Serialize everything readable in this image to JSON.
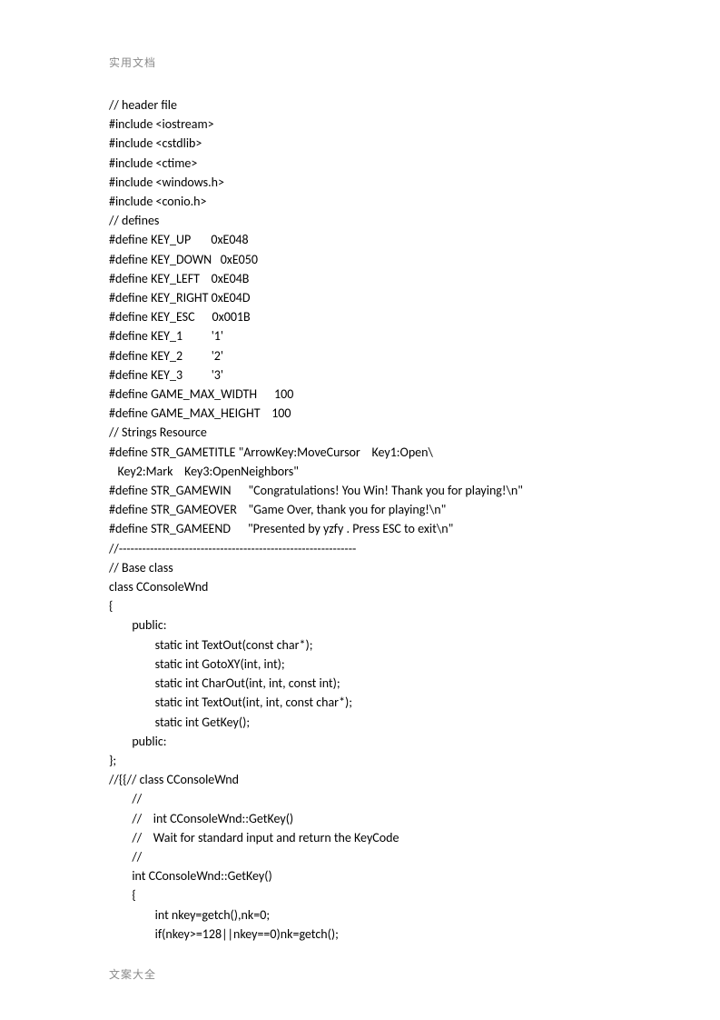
{
  "header": "实用文档",
  "footer": "文案大全",
  "code_lines": [
    "// header file",
    "#include <iostream>",
    "#include <cstdlib>",
    "#include <ctime>",
    "#include <windows.h>",
    "#include <conio.h>",
    "// defines",
    "#define KEY_UP       0xE048",
    "#define KEY_DOWN   0xE050",
    "#define KEY_LEFT    0xE04B",
    "#define KEY_RIGHT 0xE04D",
    "#define KEY_ESC      0x001B",
    "#define KEY_1          '1'",
    "#define KEY_2          '2'",
    "#define KEY_3          '3'",
    "#define GAME_MAX_WIDTH      100",
    "#define GAME_MAX_HEIGHT    100",
    "// Strings Resource",
    "#define STR_GAMETITLE \"ArrowKey:MoveCursor    Key1:Open\\",
    "   Key2:Mark    Key3:OpenNeighbors\"",
    "#define STR_GAMEWIN      \"Congratulations! You Win! Thank you for playing!\\n\"",
    "#define STR_GAMEOVER    \"Game Over, thank you for playing!\\n\"",
    "#define STR_GAMEEND      \"Presented by yzfy . Press ESC to exit\\n\"",
    "//-------------------------------------------------------------",
    "// Base class",
    "class CConsoleWnd",
    "{",
    "        public:",
    "                static int TextOut(const char*);",
    "                static int GotoXY(int, int);",
    "                static int CharOut(int, int, const int);",
    "                static int TextOut(int, int, const char*);",
    "                static int GetKey();",
    "        public:",
    "};",
    "//{{// class CConsoleWnd",
    "        //",
    "        //    int CConsoleWnd::GetKey()",
    "        //    Wait for standard input and return the KeyCode",
    "        //",
    "        int CConsoleWnd::GetKey()",
    "        {",
    "                int nkey=getch(),nk=0;",
    "                if(nkey>=128||nkey==0)nk=getch();"
  ]
}
